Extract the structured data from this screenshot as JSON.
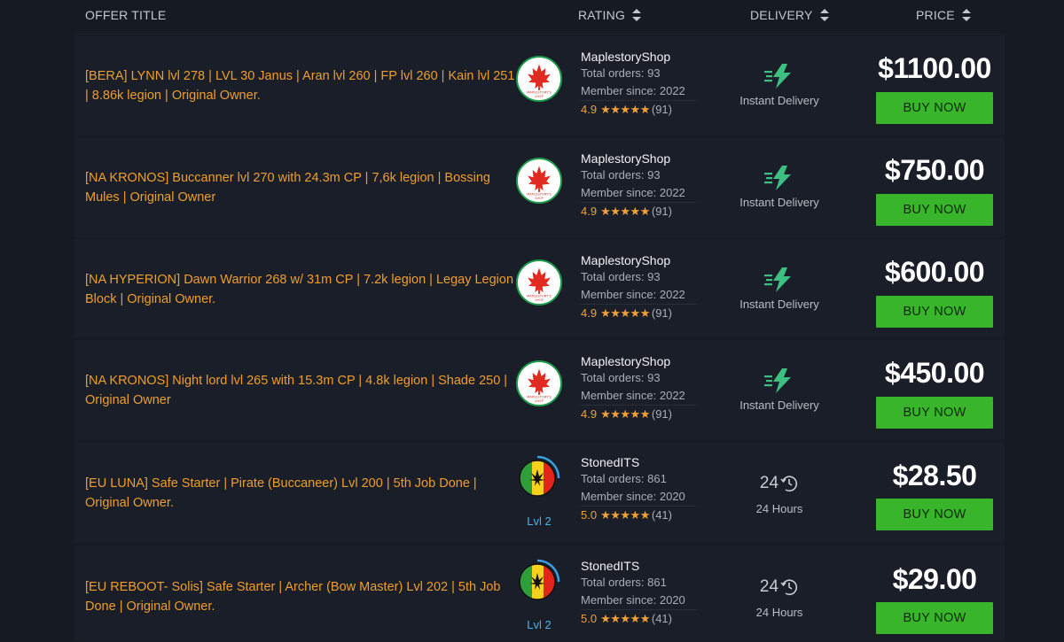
{
  "header": {
    "offer_title": "OFFER TITLE",
    "rating": "RATING",
    "delivery": "DELIVERY",
    "price": "PRICE"
  },
  "colors": {
    "background": "#161a23",
    "row": "#1a1e28",
    "title": "#ee9e2c",
    "accent_green": "#39b52b",
    "star": "#f2a13a",
    "level": "#4fb0e6"
  },
  "offers": [
    {
      "title": "[BERA] LYNN lvl 278 | LVL 30 Janus | Aran lvl 260 | FP lvl 260 | Kain lvl 251 | 8.86k legion | Original Owner.",
      "seller": "MaplestoryShop",
      "avatar_icon": "maple-leaf-logo",
      "total_orders": "Total orders: 93",
      "member_since": "Member since: 2022",
      "score": "4.9",
      "stars": "★★★★★",
      "reviews": "(91)",
      "delivery_icon": "lightning-icon",
      "delivery": "Instant Delivery",
      "price": "$1100.00",
      "buy_label": "BUY NOW"
    },
    {
      "title": "[NA KRONOS] Buccanner lvl 270 with 24.3m CP | 7,6k legion | Bossing Mules | Original Owner",
      "seller": "MaplestoryShop",
      "avatar_icon": "maple-leaf-logo",
      "total_orders": "Total orders: 93",
      "member_since": "Member since: 2022",
      "score": "4.9",
      "stars": "★★★★★",
      "reviews": "(91)",
      "delivery_icon": "lightning-icon",
      "delivery": "Instant Delivery",
      "price": "$750.00",
      "buy_label": "BUY NOW"
    },
    {
      "title": "[NA HYPERION] Dawn Warrior 268 w/ 31m CP | 7.2k legion | Legay Legion Block | Original Owner.",
      "seller": "MaplestoryShop",
      "avatar_icon": "maple-leaf-logo",
      "total_orders": "Total orders: 93",
      "member_since": "Member since: 2022",
      "score": "4.9",
      "stars": "★★★★★",
      "reviews": "(91)",
      "delivery_icon": "lightning-icon",
      "delivery": "Instant Delivery",
      "price": "$600.00",
      "buy_label": "BUY NOW"
    },
    {
      "title": "[NA KRONOS] Night lord lvl 265 with 15.3m CP | 4.8k legion | Shade 250 | Original Owner",
      "seller": "MaplestoryShop",
      "avatar_icon": "maple-leaf-logo",
      "total_orders": "Total orders: 93",
      "member_since": "Member since: 2022",
      "score": "4.9",
      "stars": "★★★★★",
      "reviews": "(91)",
      "delivery_icon": "lightning-icon",
      "delivery": "Instant Delivery",
      "price": "$450.00",
      "buy_label": "BUY NOW"
    },
    {
      "title": "[EU LUNA] Safe Starter | Pirate (Buccaneer) Lvl 200 | 5th Job Done | Original Owner.",
      "seller": "StonedITS",
      "avatar_icon": "rasta-flag-logo",
      "level": "Lvl 2",
      "level_progress": 0.35,
      "total_orders": "Total orders: 861",
      "member_since": "Member since: 2020",
      "score": "5.0",
      "stars": "★★★★★",
      "reviews": "(41)",
      "delivery_icon": "clock-24-icon",
      "delivery_value": "24",
      "delivery": "24 Hours",
      "price": "$28.50",
      "buy_label": "BUY NOW"
    },
    {
      "title": "[EU REBOOT- Solis] Safe Starter | Archer (Bow Master) Lvl 202 | 5th Job Done | Original Owner.",
      "seller": "StonedITS",
      "avatar_icon": "rasta-flag-logo",
      "level": "Lvl 2",
      "level_progress": 0.35,
      "total_orders": "Total orders: 861",
      "member_since": "Member since: 2020",
      "score": "5.0",
      "stars": "★★★★★",
      "reviews": "(41)",
      "delivery_icon": "clock-24-icon",
      "delivery_value": "24",
      "delivery": "24 Hours",
      "price": "$29.00",
      "buy_label": "BUY NOW"
    }
  ]
}
